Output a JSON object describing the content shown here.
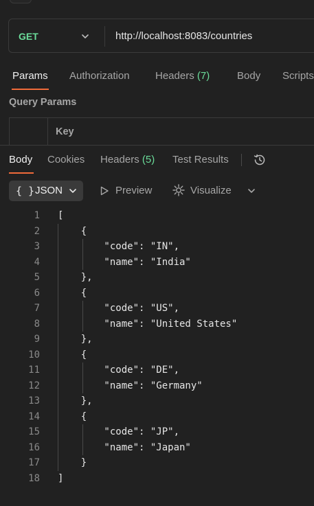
{
  "request": {
    "method": "GET",
    "url": "http://localhost:8083/countries"
  },
  "request_tabs": {
    "params": "Params",
    "authorization": "Authorization",
    "headers": "Headers",
    "headers_count": "(7)",
    "body": "Body",
    "scripts": "Scripts"
  },
  "query_params": {
    "title": "Query Params",
    "key_header": "Key"
  },
  "response_tabs": {
    "body": "Body",
    "cookies": "Cookies",
    "headers": "Headers",
    "headers_count": "(5)",
    "test_results": "Test Results"
  },
  "format_bar": {
    "format_icon": "{ }",
    "format_label": "JSON",
    "preview": "Preview",
    "visualize": "Visualize"
  },
  "code_lines": [
    {
      "n": "1",
      "text": "["
    },
    {
      "n": "2",
      "text": "    {"
    },
    {
      "n": "3",
      "text": "        \"code\": \"IN\","
    },
    {
      "n": "4",
      "text": "        \"name\": \"India\""
    },
    {
      "n": "5",
      "text": "    },"
    },
    {
      "n": "6",
      "text": "    {"
    },
    {
      "n": "7",
      "text": "        \"code\": \"US\","
    },
    {
      "n": "8",
      "text": "        \"name\": \"United States\""
    },
    {
      "n": "9",
      "text": "    },"
    },
    {
      "n": "10",
      "text": "    {"
    },
    {
      "n": "11",
      "text": "        \"code\": \"DE\","
    },
    {
      "n": "12",
      "text": "        \"name\": \"Germany\""
    },
    {
      "n": "13",
      "text": "    },"
    },
    {
      "n": "14",
      "text": "    {"
    },
    {
      "n": "15",
      "text": "        \"code\": \"JP\","
    },
    {
      "n": "16",
      "text": "        \"name\": \"Japan\""
    },
    {
      "n": "17",
      "text": "    }"
    },
    {
      "n": "18",
      "text": "]"
    }
  ],
  "colors": {
    "accent": "#f26b3a",
    "method": "#6bdd9a",
    "count": "#6bdd9a",
    "background": "#212121"
  }
}
